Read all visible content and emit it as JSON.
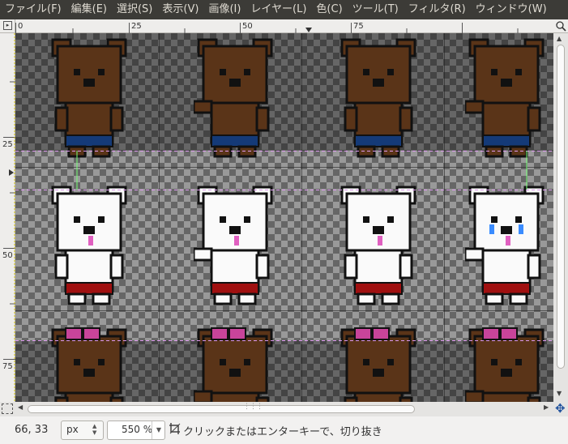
{
  "menu": [
    {
      "label": "ファイル(F)"
    },
    {
      "label": "編集(E)"
    },
    {
      "label": "選択(S)"
    },
    {
      "label": "表示(V)"
    },
    {
      "label": "画像(I)"
    },
    {
      "label": "レイヤー(L)"
    },
    {
      "label": "色(C)"
    },
    {
      "label": "ツール(T)"
    },
    {
      "label": "フィルタ(R)"
    },
    {
      "label": "ウィンドウ(W)"
    }
  ],
  "ruler": {
    "h_labels": [
      "0",
      "25",
      "50",
      "75"
    ],
    "v_labels": [
      "25",
      "50",
      "75"
    ]
  },
  "status": {
    "coords": "66, 33",
    "unit": "px",
    "zoom": "550 %",
    "message": "クリックまたはエンターキーで、切り抜き"
  },
  "colors": {
    "menubar_bg": "#3c3b37",
    "bear_brown": "#5a3418",
    "bear_white": "#fafafa",
    "shorts_blue": "#143a78",
    "shorts_red": "#a01010",
    "bow_pink": "#c8449a",
    "tongue_pink": "#e060c0",
    "tear_blue": "#3a8cff"
  },
  "icons": [
    "quick-mask-icon",
    "navigate-icon",
    "crop-tool-icon",
    "canvas-corner-menu-icon"
  ]
}
